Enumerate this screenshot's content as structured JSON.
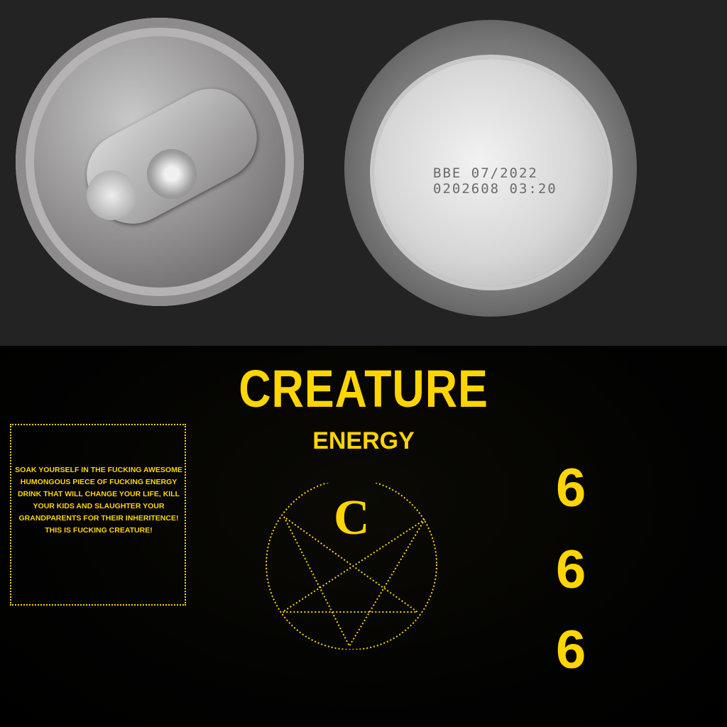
{
  "can_bottom_print": {
    "line1": "BBE 07/2022",
    "line2": "0202608 03:20"
  },
  "brand": {
    "title": "CREATURE",
    "subtitle": "ENERGY",
    "emblem_letter": "C",
    "accent": "#ffd500"
  },
  "blurb": "Soak yourself in the fucking awesome humongous piece of fucking energy drink that will change your life, kill your kids and slaughter your grandparents for their inheritence! This is fucking Creature!",
  "numbers": [
    "6",
    "6",
    "6"
  ],
  "icons": {
    "emblem": "pentagram-icon"
  }
}
